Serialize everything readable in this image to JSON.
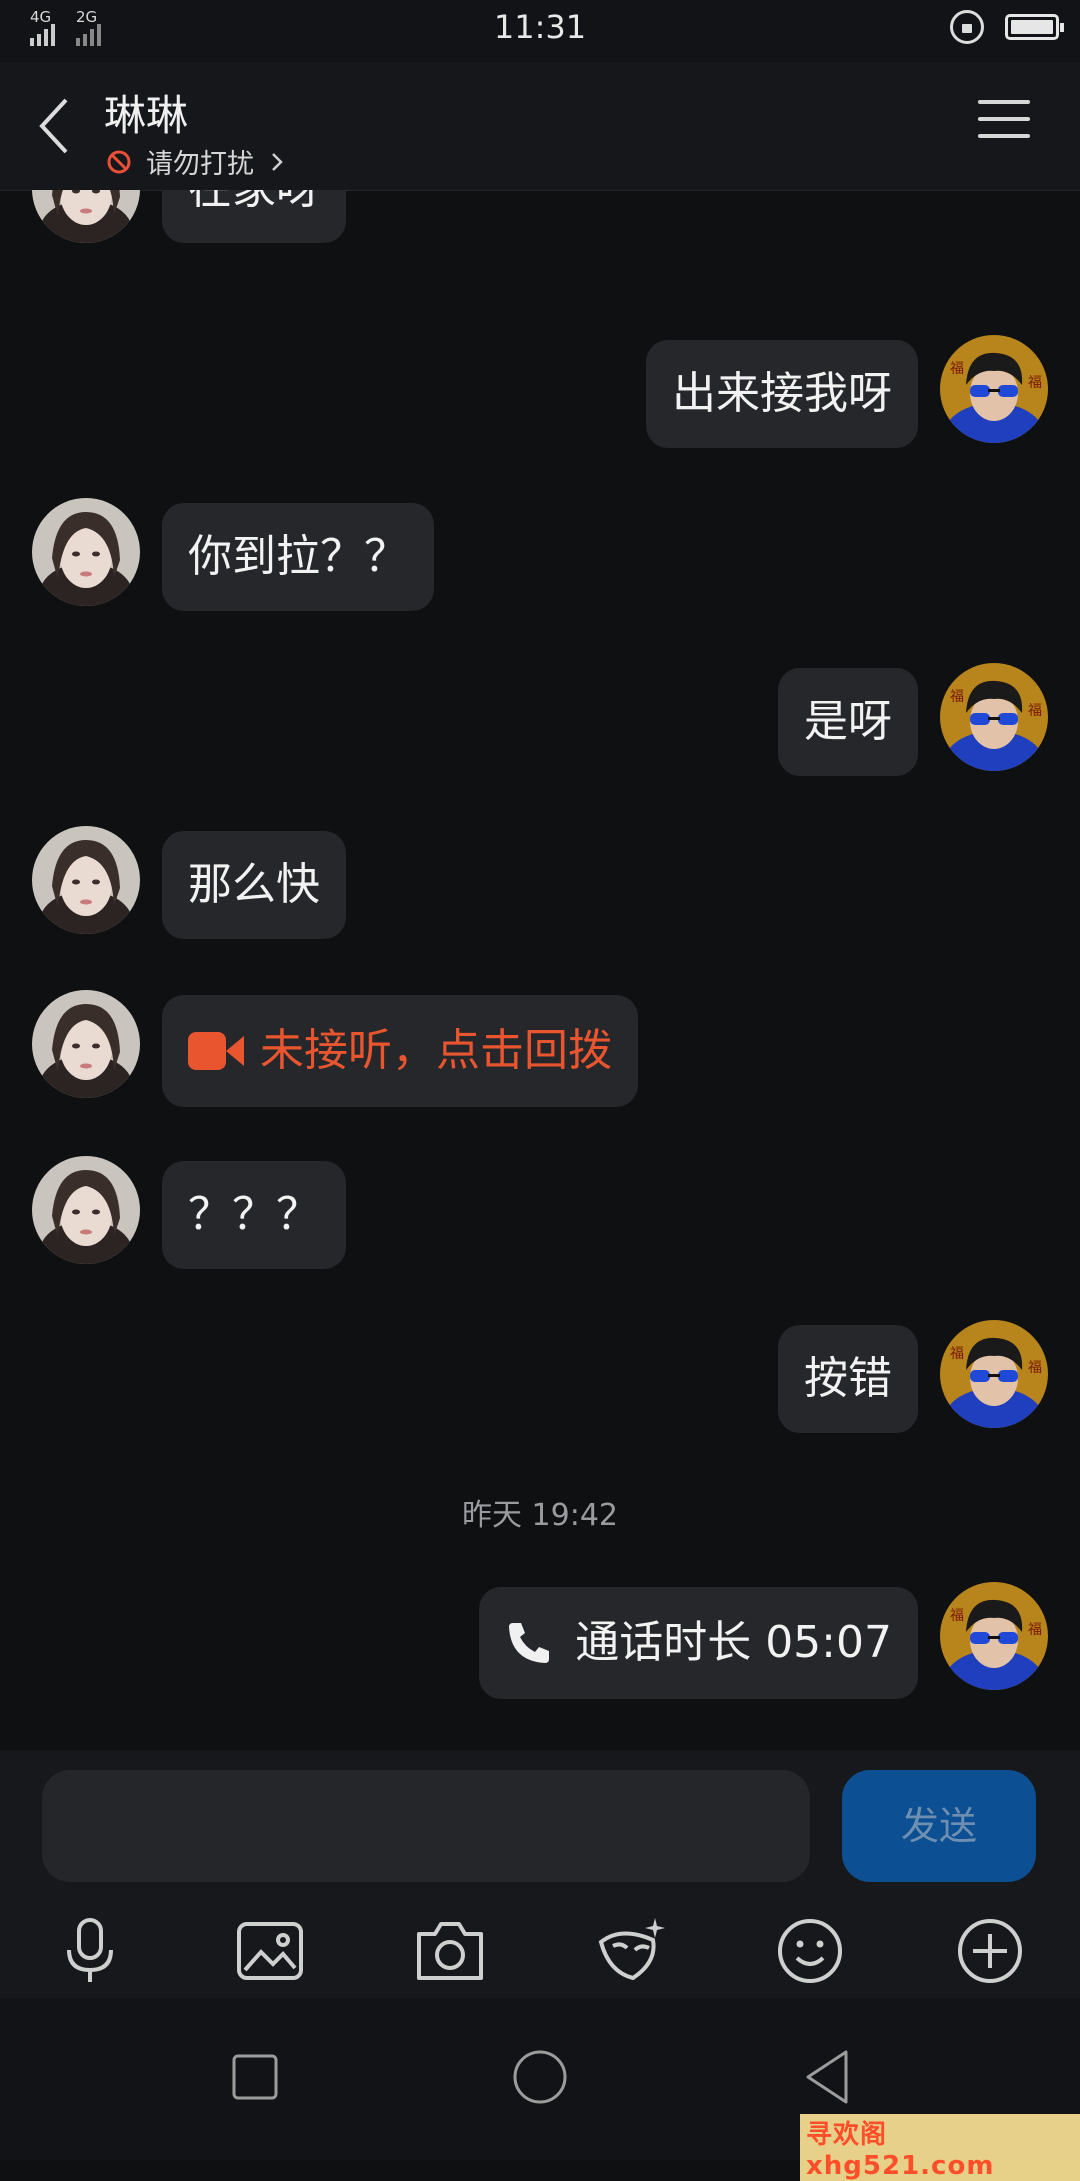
{
  "status_bar": {
    "signal1": "4G",
    "signal2": "2G",
    "time": "11:31"
  },
  "header": {
    "title": "琳琳",
    "status": "请勿打扰"
  },
  "messages": [
    {
      "side": "left",
      "text": "在家呀"
    },
    {
      "side": "right",
      "text": "出来接我呀"
    },
    {
      "side": "left",
      "text": "你到拉？？"
    },
    {
      "side": "right",
      "text": "是呀"
    },
    {
      "side": "left",
      "text": "那么快"
    },
    {
      "side": "left",
      "type": "missed_video",
      "text": "未接听，点击回拨"
    },
    {
      "side": "left",
      "text": "？？？"
    },
    {
      "side": "right",
      "text": "按错"
    },
    {
      "type": "timestamp",
      "text": "昨天 19:42"
    },
    {
      "side": "right",
      "type": "call",
      "text": "通话时长 05:07"
    }
  ],
  "input": {
    "placeholder": "",
    "send_label": "发送"
  },
  "toolbar": [
    "microphone-icon",
    "image-icon",
    "camera-icon",
    "sticker-icon",
    "emoji-icon",
    "plus-icon"
  ],
  "watermark": "寻欢阁xhg521.com",
  "colors": {
    "background": "#0f1012",
    "bubble": "#26272b",
    "missed": "#e8552f",
    "send": "#0d4f93"
  }
}
